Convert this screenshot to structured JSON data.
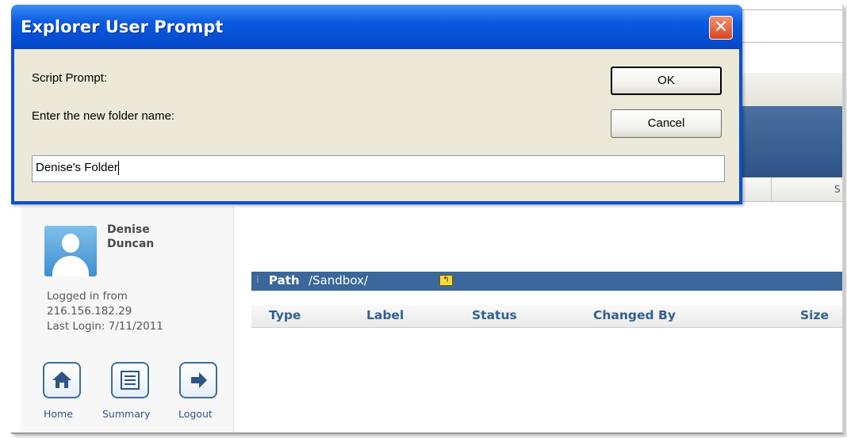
{
  "dialog": {
    "title": "Explorer User Prompt",
    "script_prompt": "Script Prompt:",
    "message": "Enter the new folder name:",
    "input_value": "Denise's Folder",
    "ok_label": "OK",
    "cancel_label": "Cancel",
    "close_glyph": "✕"
  },
  "colbar": {
    "partial_label": "S"
  },
  "user": {
    "first_name": "Denise",
    "last_name": "Duncan",
    "logged_in_label": "Logged in from",
    "ip": "216.156.182.29",
    "last_login": "Last Login: 7/11/2011"
  },
  "nav": {
    "home": "Home",
    "summary": "Summary",
    "logout": "Logout"
  },
  "path": {
    "label": "Path",
    "value": "/Sandbox/"
  },
  "table": {
    "columns": [
      "Type",
      "Label",
      "Status",
      "Changed By",
      "Size"
    ]
  },
  "colors": {
    "titlebar": "#0a5ae0",
    "dialog_client": "#ece9d8",
    "app_accent": "#345f91"
  }
}
